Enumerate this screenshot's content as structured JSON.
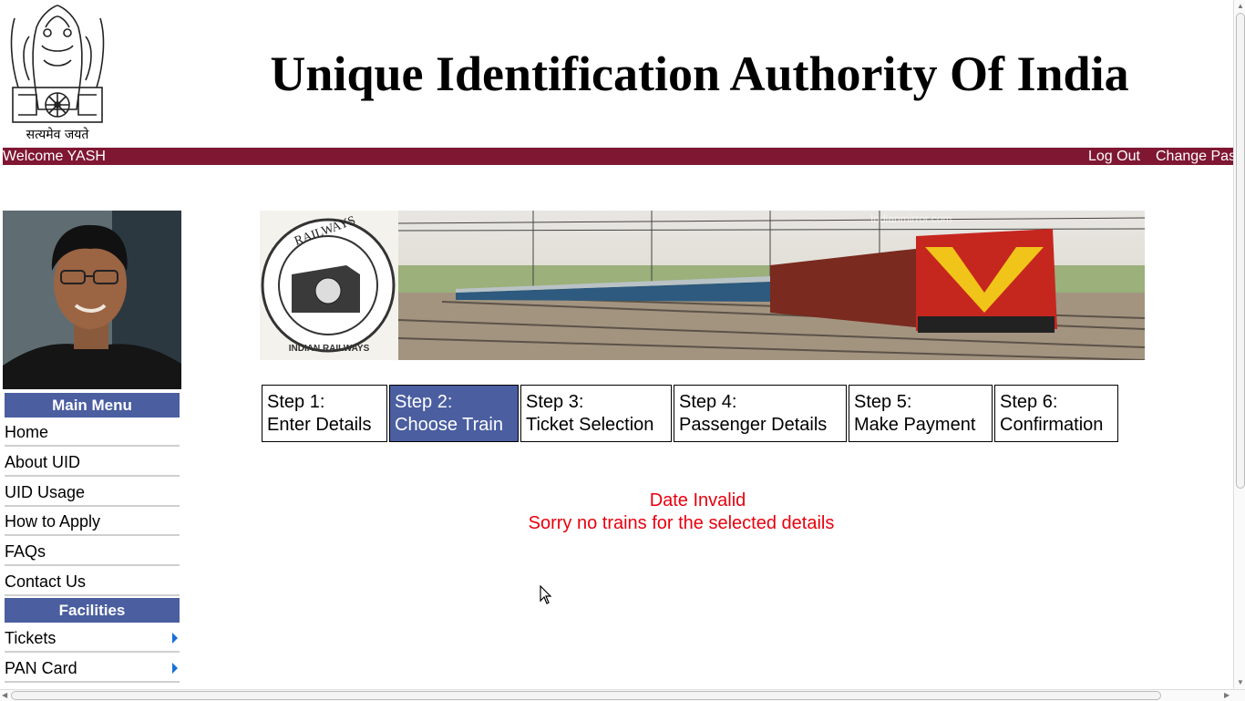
{
  "header": {
    "emblem_motto": "सत्यमेव जयते",
    "title": "Unique Identification Authority Of India"
  },
  "topbar": {
    "welcome": "Welcome YASH",
    "logout": "Log Out",
    "change_password": "Change Pas"
  },
  "banner": {
    "logo_text": "INDIAN RAILWAYS",
    "watermark": "Indianmirror.com"
  },
  "main_menu": {
    "heading": "Main Menu",
    "items": [
      "Home",
      "About UID",
      "UID Usage",
      "How to Apply",
      "FAQs",
      "Contact Us"
    ]
  },
  "facilities": {
    "heading": "Facilities",
    "items": [
      "Tickets",
      "PAN Card"
    ]
  },
  "steps": [
    {
      "num": "Step 1:",
      "label": "Enter Details",
      "active": false
    },
    {
      "num": "Step 2:",
      "label": "Choose Train",
      "active": true
    },
    {
      "num": "Step 3:",
      "label": "Ticket Selection",
      "active": false
    },
    {
      "num": "Step 4:",
      "label": "Passenger Details",
      "active": false
    },
    {
      "num": "Step 5:",
      "label": "Make Payment",
      "active": false
    },
    {
      "num": "Step 6:",
      "label": "Confirmation",
      "active": false
    }
  ],
  "messages": {
    "error_date": "Date Invalid",
    "error_trains": "Sorry no trains for the selected details"
  },
  "colors": {
    "topbar": "#7f1733",
    "menu_heading": "#4a5ea0",
    "active_step": "#4a5ea0",
    "error_text": "#e8000d"
  }
}
